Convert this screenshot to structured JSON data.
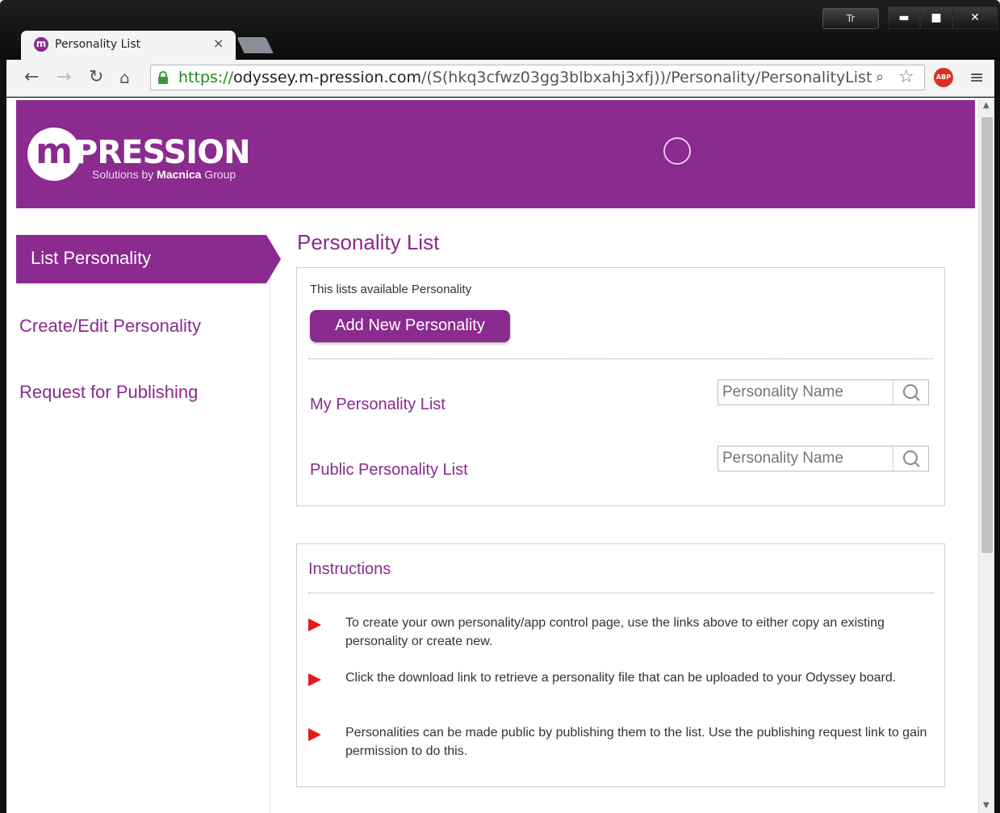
{
  "browser": {
    "tab_title": "Personality List",
    "tab_close": "×",
    "extra_button": "Tr",
    "window_controls": {
      "minimize": "▬",
      "maximize": "■",
      "close": "✕"
    },
    "url": {
      "scheme": "https://",
      "host": "odyssey.m-pression.com",
      "path": "/(S(hkq3cfwz03gg3blbxahj3xfj))/Personality/PersonalityList"
    },
    "abp_label": "ABP",
    "icons": [
      "back-icon",
      "forward-icon",
      "reload-icon",
      "home-icon",
      "lock-icon",
      "zoom-icon",
      "star-icon",
      "menu-icon"
    ]
  },
  "header": {
    "logo_mark": "m",
    "logo_word": "PRESSION",
    "logo_sub_prefix": "Solutions by ",
    "logo_sub_brand": "Macnica",
    "logo_sub_suffix": " Group"
  },
  "sidebar": {
    "items": [
      {
        "label": "List Personality",
        "active": true
      },
      {
        "label": "Create/Edit Personality",
        "active": false
      },
      {
        "label": "Request for Publishing",
        "active": false
      }
    ]
  },
  "main": {
    "title": "Personality List",
    "intro": "This lists available Personality",
    "add_button": "Add New Personality",
    "lists": [
      {
        "label": "My Personality List",
        "search_placeholder": "Personality Name"
      },
      {
        "label": "Public Personality List",
        "search_placeholder": "Personality Name"
      }
    ],
    "instructions": {
      "title": "Instructions",
      "items": [
        "To create your own personality/app control page, use the links above to either copy an existing personality or create new.",
        "Click the download link to retrieve a personality file that can be uploaded to your Odyssey board.",
        "Personalities can be made public by publishing them to the list. Use the publishing request link to gain permission to do this."
      ]
    }
  },
  "colors": {
    "brand": "#8b2a8f",
    "bullet": "#e41b1b",
    "url_https": "#1f8a1f"
  }
}
